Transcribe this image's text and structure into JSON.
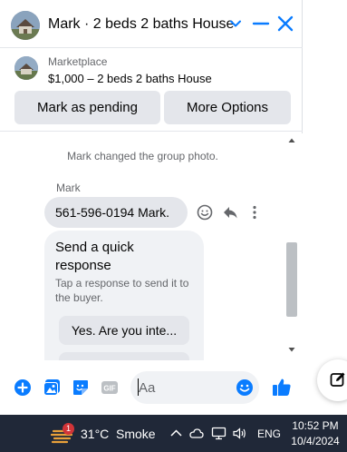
{
  "chat": {
    "title": "Mark · 2 beds 2 baths House",
    "listing": {
      "source": "Marketplace",
      "price_title": "$1,000 – 2 beds 2 baths House",
      "mark_pending_label": "Mark as pending",
      "more_options_label": "More Options"
    },
    "messages": {
      "system_note": "Mark changed the group photo.",
      "sender": "Mark",
      "text": "561-596-0194 Mark.",
      "quick_card": {
        "title": "Send a quick response",
        "subtitle": "Tap a response to send it to the buyer.",
        "option1": "Yes. Are you inte..."
      }
    },
    "composer": {
      "placeholder": "Aa",
      "gif_label": "GIF"
    },
    "accent_color": "#0a7cff"
  },
  "taskbar": {
    "weather_badge": "1",
    "temperature": "31°C",
    "condition": "Smoke",
    "language": "ENG",
    "time": "10:52 PM",
    "date": "10/4/2024"
  }
}
